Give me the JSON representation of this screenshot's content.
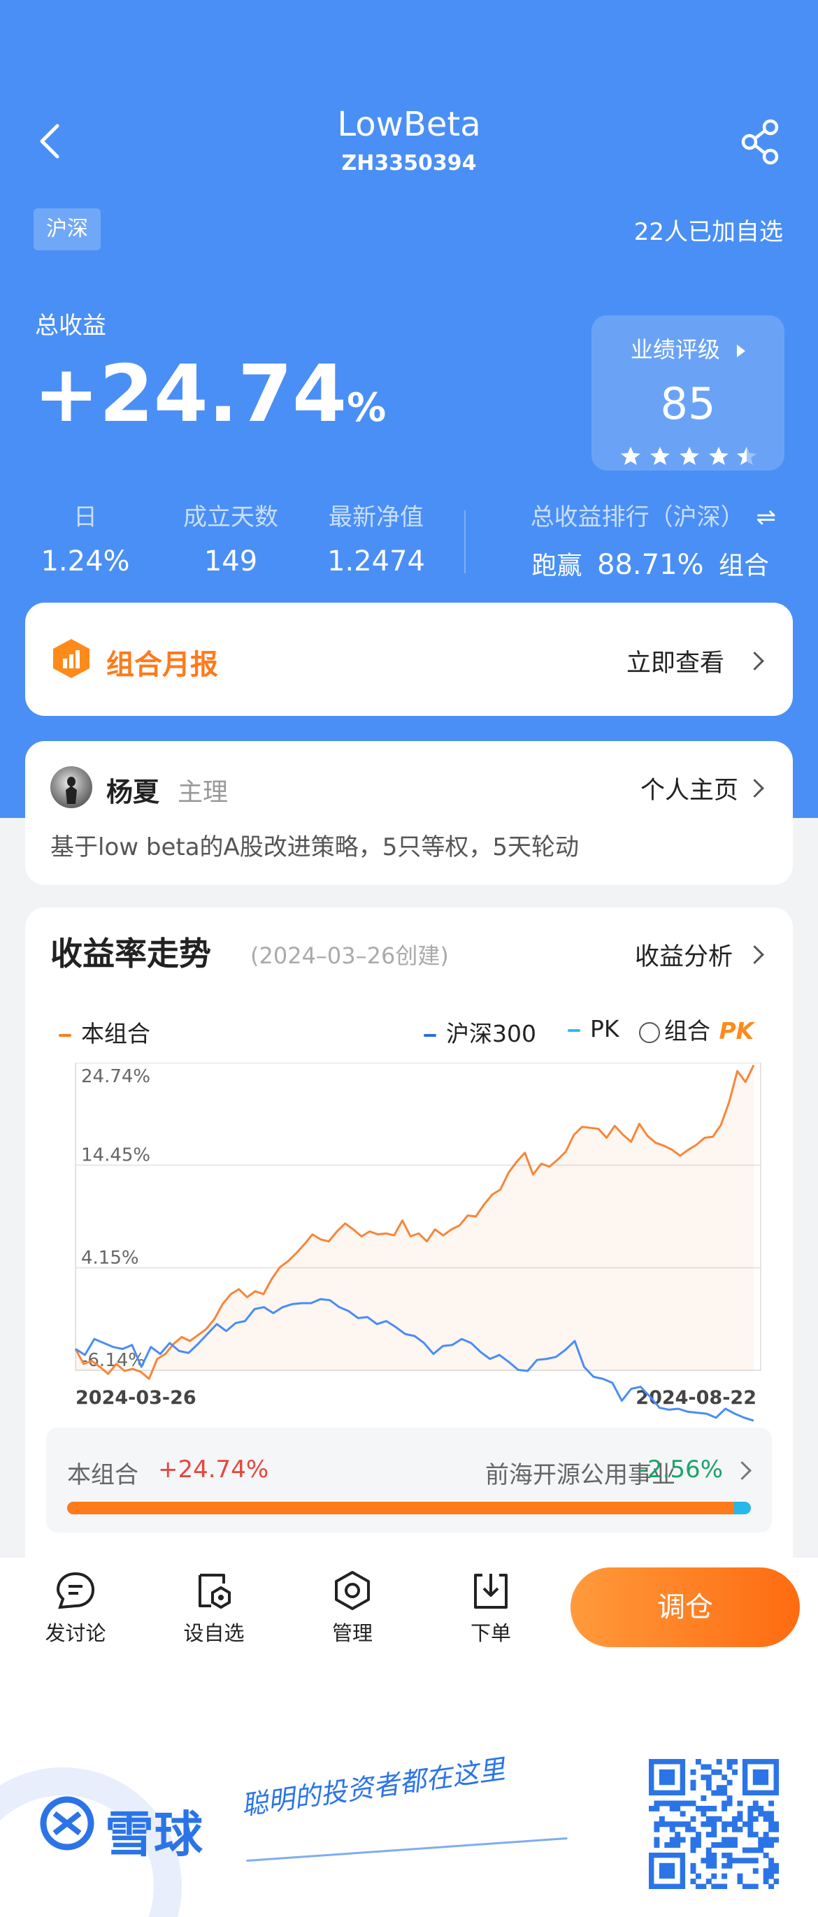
{
  "header": {
    "title": "LowBeta",
    "code": "ZH3350394"
  },
  "market_tag": "沪深",
  "followers": "22人已加自选",
  "total_return": {
    "label": "总收益",
    "sign_value": "+24.74",
    "unit": "%"
  },
  "rating": {
    "label": "业绩评级",
    "score": "85",
    "stars": 4.5
  },
  "stats": [
    {
      "label": "日",
      "value": "1.24%"
    },
    {
      "label": "成立天数",
      "value": "149"
    },
    {
      "label": "最新净值",
      "value": "1.2474"
    }
  ],
  "ranking": {
    "label": "总收益排行（沪深）",
    "prefix": "跑赢",
    "value": "88.71%",
    "suffix": "组合"
  },
  "monthly_report": {
    "title": "组合月报",
    "action": "立即查看"
  },
  "manager": {
    "name": "杨夏",
    "role": "主理",
    "action": "个人主页",
    "description": "基于low beta的A股改进策略，5只等权，5天轮动"
  },
  "chart_card": {
    "title": "收益率走势",
    "created": "(2024–03–26创建)",
    "action": "收益分析"
  },
  "legend": {
    "series1": "本组合",
    "series2": "沪深300",
    "series3": "PK",
    "series4": "组合",
    "pk_logo": "PK"
  },
  "chart_data": {
    "type": "line",
    "y_tick_labels": [
      "24.74%",
      "14.45%",
      "4.15%",
      "-6.14%"
    ],
    "ylim": [
      -6.14,
      24.74
    ],
    "x_labels": [
      "2024-03-26",
      "2024-08-22"
    ],
    "series": [
      {
        "name": "本组合",
        "color": "#f7863a",
        "values": [
          -4.0,
          -5.5,
          -5.2,
          -5.8,
          -6.5,
          -5.5,
          -6.2,
          -6.0,
          -6.3,
          -7.0,
          -5.0,
          -4.5,
          -3.5,
          -2.8,
          -3.2,
          -2.6,
          -2.0,
          -1.0,
          0.5,
          1.5,
          2.0,
          1.2,
          1.8,
          1.5,
          3.0,
          4.2,
          4.8,
          5.6,
          6.5,
          7.5,
          7.0,
          6.8,
          7.8,
          8.6,
          8.0,
          7.3,
          7.8,
          7.5,
          7.6,
          7.4,
          8.9,
          7.3,
          7.6,
          6.8,
          8.0,
          7.4,
          8.0,
          8.4,
          9.4,
          9.3,
          10.5,
          11.5,
          12.0,
          13.7,
          14.8,
          15.7,
          13.5,
          14.6,
          14.3,
          15.0,
          15.8,
          17.5,
          18.3,
          18.2,
          18.1,
          17.2,
          18.4,
          17.5,
          16.8,
          18.6,
          17.4,
          16.7,
          16.4,
          16.0,
          15.4,
          16.0,
          16.5,
          17.2,
          17.3,
          18.5,
          20.8,
          23.9,
          22.8,
          24.5
        ]
      },
      {
        "name": "沪深300",
        "color": "#4a8df5",
        "values": [
          -4.0,
          -4.6,
          -3.0,
          -3.4,
          -3.8,
          -4.0,
          -3.6,
          -5.8,
          -3.8,
          -4.5,
          -3.4,
          -4.2,
          -4.4,
          -3.5,
          -2.5,
          -1.5,
          -2.2,
          -1.4,
          -1.2,
          0.0,
          0.2,
          -0.4,
          0.2,
          0.5,
          0.6,
          0.6,
          1.0,
          0.9,
          0.2,
          -0.2,
          -0.9,
          -0.8,
          -1.5,
          -1.2,
          -1.8,
          -2.5,
          -2.7,
          -3.4,
          -4.5,
          -3.7,
          -3.6,
          -3.0,
          -3.4,
          -4.3,
          -5.0,
          -4.6,
          -5.3,
          -6.1,
          -6.2,
          -5.1,
          -5.0,
          -4.8,
          -4.1,
          -3.2,
          -5.8,
          -6.8,
          -7.0,
          -7.4,
          -9.2,
          -8.0,
          -7.8,
          -8.8,
          -9.9,
          -10.1,
          -10.0,
          -10.3,
          -10.4,
          -10.5,
          -10.9,
          -10.0,
          -10.5,
          -10.9,
          -11.2
        ]
      }
    ]
  },
  "comparison": {
    "left_label": "本组合",
    "left_value": "+24.74%",
    "right_label": "前海开源公用事业",
    "right_value": "-2.56%",
    "progress": 0.975
  },
  "toolbar": {
    "discuss": "发讨论",
    "watch": "设自选",
    "manage": "管理",
    "order": "下单",
    "rebalance": "调仓"
  },
  "footer": {
    "brand": "雪球",
    "slogan": "聪明的投资者都在这里"
  },
  "colors": {
    "primary": "#4a8ff5",
    "orange": "#ff7a1a",
    "red": "#e8453c",
    "green": "#1aa36a"
  }
}
